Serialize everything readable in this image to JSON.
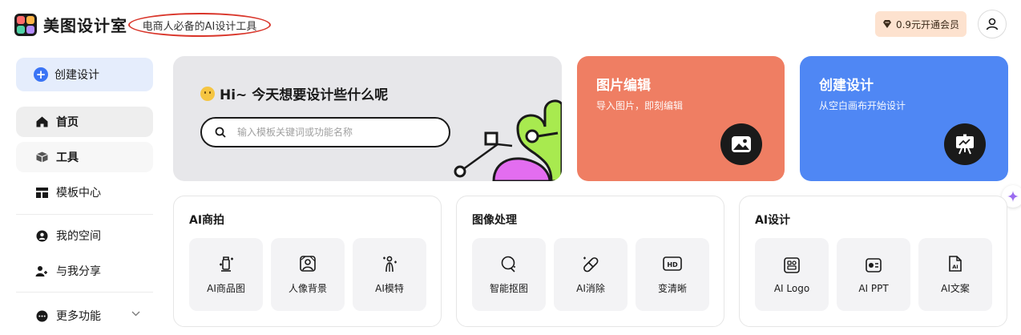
{
  "header": {
    "app_name": "美图设计室",
    "slogan": "电商人必备的AI设计工具",
    "vip_button": "0.9元开通会员",
    "avatar_icon": "user-icon"
  },
  "sidebar": {
    "create": "创建设计",
    "items": [
      {
        "label": "首页",
        "icon": "home-icon"
      },
      {
        "label": "工具",
        "icon": "toolbox-icon"
      },
      {
        "label": "模板中心",
        "icon": "template-icon"
      },
      {
        "label": "我的空间",
        "icon": "user-circle-icon"
      },
      {
        "label": "与我分享",
        "icon": "share-user-icon"
      },
      {
        "label": "更多功能",
        "icon": "more-icon"
      }
    ]
  },
  "hero": {
    "greeting": "Hi~ 今天想要设计些什么呢",
    "search_placeholder": "输入模板关键词或功能名称"
  },
  "features": {
    "edit": {
      "title": "图片编辑",
      "subtitle": "导入图片，即刻编辑",
      "icon": "image-icon"
    },
    "create": {
      "title": "创建设计",
      "subtitle": "从空白画布开始设计",
      "icon": "canvas-board-icon"
    }
  },
  "sections": [
    {
      "title": "AI商拍",
      "tools": [
        "AI商品图",
        "人像背景",
        "AI模特"
      ]
    },
    {
      "title": "图像处理",
      "tools": [
        "智能抠图",
        "AI消除",
        "变清晰"
      ]
    },
    {
      "title": "AI设计",
      "tools": [
        "AI Logo",
        "AI PPT",
        "AI文案"
      ]
    }
  ],
  "colors": {
    "accent_blue": "#4f87f4",
    "accent_orange": "#ef7e63",
    "slogan_circle": "#d9362b",
    "vip_bg": "#fde2cf"
  }
}
